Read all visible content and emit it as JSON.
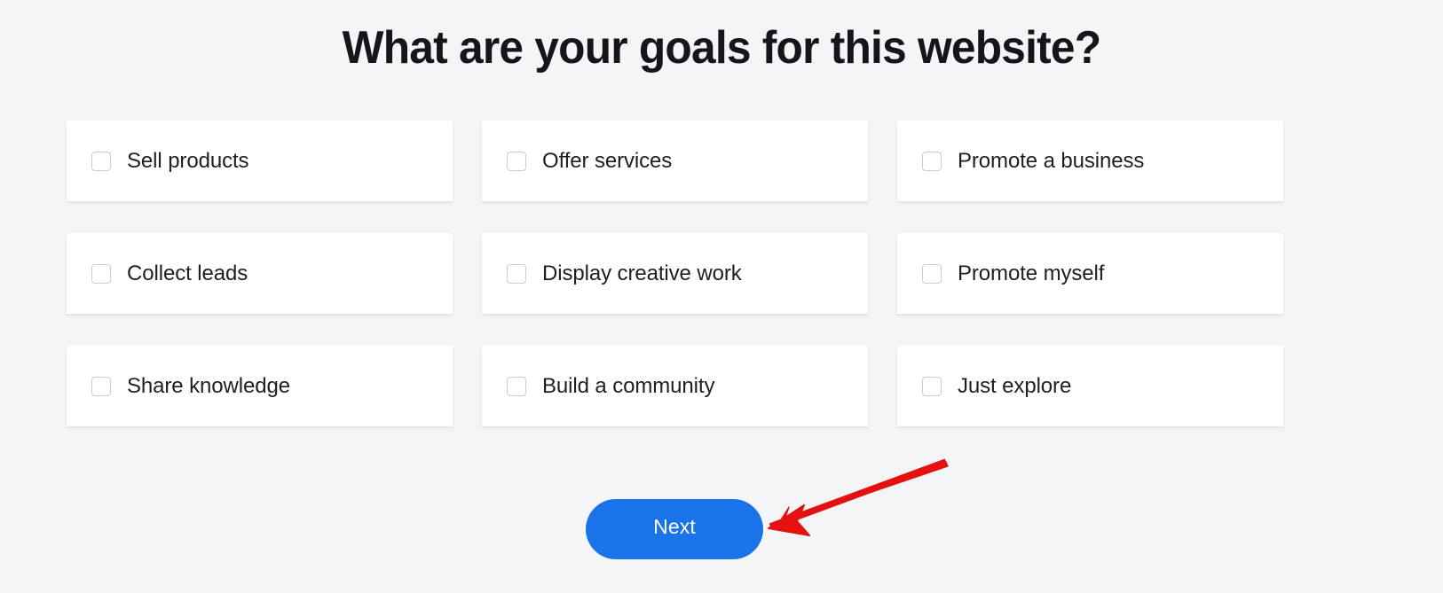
{
  "page": {
    "title": "What are your goals for this website?",
    "background_color": "#f4f5f7",
    "heading_color": "#14161b"
  },
  "goals": {
    "checkbox_icon": "checkbox-unchecked-icon",
    "items": [
      {
        "label": "Sell products",
        "checked": false
      },
      {
        "label": "Offer services",
        "checked": false
      },
      {
        "label": "Promote a business",
        "checked": false
      },
      {
        "label": "Collect leads",
        "checked": false
      },
      {
        "label": "Display creative work",
        "checked": false
      },
      {
        "label": "Promote myself",
        "checked": false
      },
      {
        "label": "Share knowledge",
        "checked": false
      },
      {
        "label": "Build a community",
        "checked": false
      },
      {
        "label": "Just explore",
        "checked": false
      }
    ]
  },
  "actions": {
    "next_label": "Next",
    "next_color": "#1a73e8",
    "next_text_color": "#ffffff"
  },
  "annotation": {
    "arrow_icon": "arrow-pointing-left-icon",
    "arrow_color": "#e51010",
    "points_to": "Next"
  }
}
